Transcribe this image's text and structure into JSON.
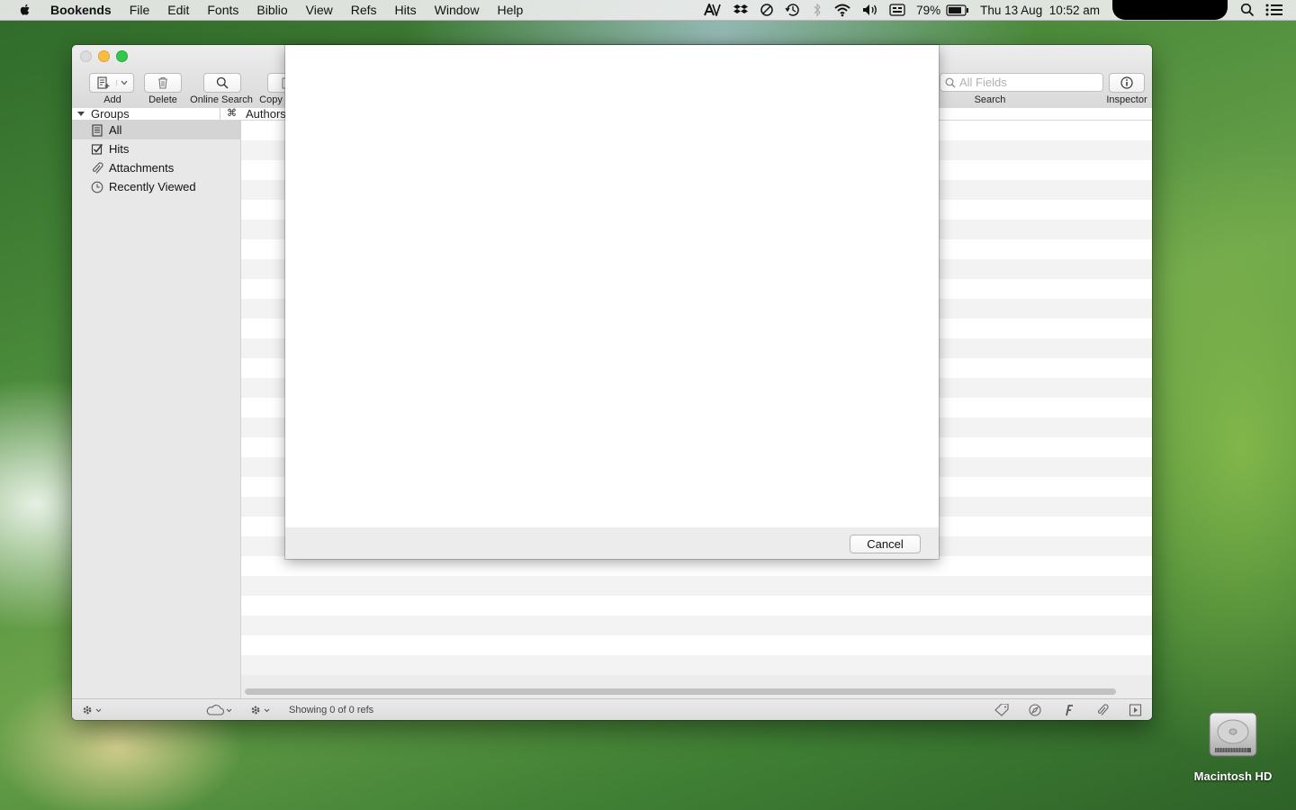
{
  "menubar": {
    "app_name": "Bookends",
    "items": [
      "File",
      "Edit",
      "Fonts",
      "Biblio",
      "View",
      "Refs",
      "Hits",
      "Window",
      "Help"
    ],
    "battery": "79%",
    "clock": "Thu 13 Aug  10:52 am",
    "status_icons": [
      "adobe-icon",
      "dropbox-icon",
      "sync-icon",
      "time-machine-icon",
      "bluetooth-icon",
      "wifi-icon",
      "volume-icon",
      "input-menu-icon",
      "battery-icon",
      "spotlight-icon",
      "notification-center-icon"
    ]
  },
  "window": {
    "toolbar": {
      "add_label": "Add",
      "delete_label": "Delete",
      "online_search_label": "Online Search",
      "copy_label": "Copy",
      "search_placeholder": "All Fields",
      "search_label": "Search",
      "inspector_label": "Inspector"
    },
    "groups_header": "Groups",
    "authors_header": "Authors",
    "shortcut_symbol": "⌘",
    "sidebar": {
      "items": [
        {
          "label": "All",
          "icon": "library-icon",
          "selected": true
        },
        {
          "label": "Hits",
          "icon": "checkbox-icon",
          "selected": false
        },
        {
          "label": "Attachments",
          "icon": "paperclip-icon",
          "selected": false
        },
        {
          "label": "Recently Viewed",
          "icon": "clock-icon",
          "selected": false
        }
      ]
    },
    "status": "Showing 0 of 0 refs"
  },
  "sheet": {
    "cancel_label": "Cancel"
  },
  "desktop": {
    "disk_label": "Macintosh HD"
  }
}
